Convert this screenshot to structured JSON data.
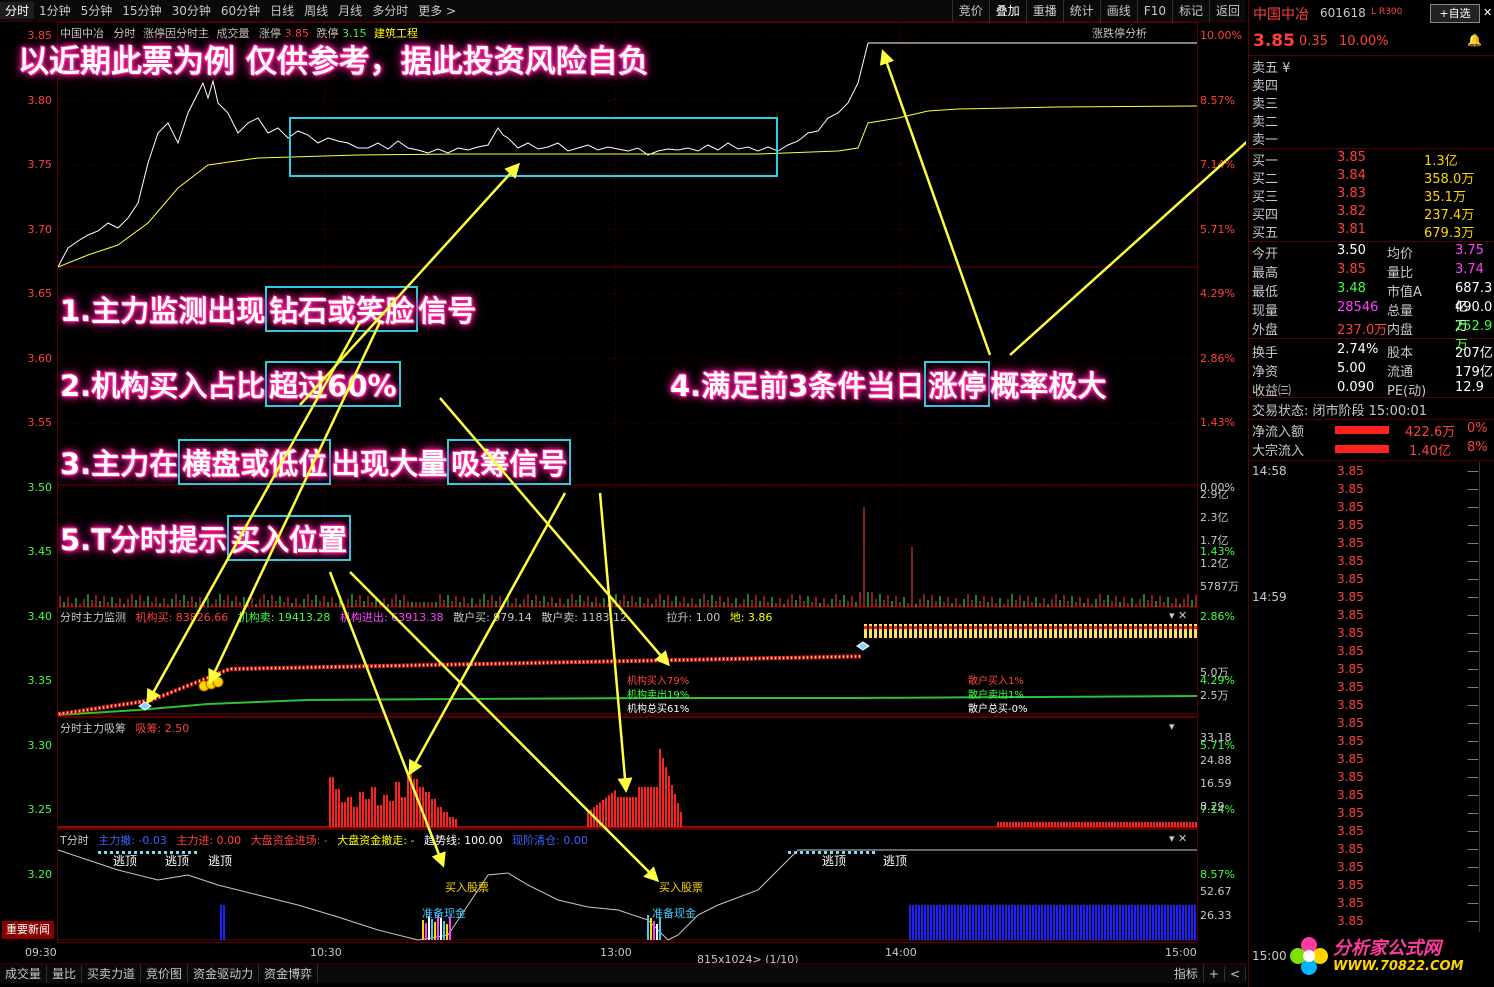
{
  "toolbar": {
    "tabs": [
      "分时",
      "1分钟",
      "5分钟",
      "15分钟",
      "30分钟",
      "60分钟",
      "日线",
      "周线",
      "月线",
      "多分时",
      "更多 >"
    ],
    "right": [
      "竞价",
      "叠加",
      "重播",
      "统计",
      "画线",
      "F10",
      "标记",
      "返回"
    ]
  },
  "main_header": {
    "name": "中国中冶",
    "mode": "分时",
    "limit_label": "涨停因分时主",
    "volume_label": "成交量",
    "up_label": "涨停",
    "up_val": "3.85",
    "down_label": "跌停",
    "down_val": "3.15",
    "sector": "建筑工程",
    "analysis_btn": "涨跌停分析"
  },
  "price_axis": [
    "3.85",
    "3.80",
    "3.75",
    "3.70",
    "3.65",
    "3.60",
    "3.55",
    "3.50",
    "3.45",
    "3.40",
    "3.35",
    "3.30",
    "3.25",
    "3.20"
  ],
  "pct_axis": [
    "10.00%",
    "8.57%",
    "7.14%",
    "5.71%",
    "4.29%",
    "2.86%",
    "1.43%",
    "0.00%",
    "1.43%",
    "2.86%",
    "4.29%",
    "5.71%",
    "7.14%",
    "8.57%"
  ],
  "vol_axis": [
    "2.9亿",
    "2.3亿",
    "1.7亿",
    "1.2亿",
    "5787万"
  ],
  "monitor": {
    "title": "分时主力监测",
    "org_buy": "机构买: 83826.66",
    "org_sell": "机构卖: 19413.28",
    "org_in": "机构进出: 63913.38",
    "retail_buy": "散户买: 979.14",
    "retail_sell": "散户卖: 1183.12",
    "raise_label": "拉升: 1.00",
    "ground": "地: 3.86",
    "axis": [
      "5.0万",
      "2.5万"
    ],
    "legend_org": [
      "机构买入79%",
      "机构卖出19%",
      "机构总买61%"
    ],
    "legend_retail": [
      "散户买入1%",
      "散户卖出1%",
      "散户总买-0%"
    ]
  },
  "accum": {
    "title": "分时主力吸筹",
    "value": "吸筹: 2.50",
    "axis": [
      "33.18",
      "24.88",
      "16.59",
      "8.29"
    ]
  },
  "tpanel": {
    "title": "T分时",
    "main_retreat": "主力撤: -0.03",
    "main_in": "主力进: 0.00",
    "market_in": "大盘资金进场: -",
    "market_out": "大盘资金撤走: -",
    "trend": "趋势线: 100.00",
    "cash": "现阶清仓: 0.00",
    "axis": [
      "52.67",
      "26.33"
    ],
    "flee": "逃顶",
    "buy": "买入股票",
    "prep": "准备现金"
  },
  "news_btn": "重要新闻",
  "time_axis": [
    "09:30",
    "10:30",
    "13:00",
    "14:00",
    "15:00"
  ],
  "page_info": "815x1024> (1/10)",
  "bottom_tabs": [
    "成交量",
    "量比",
    "买卖力道",
    "竞价图",
    "资金驱动力",
    "资金博弈"
  ],
  "bottom_right": [
    "指标",
    "+",
    "<"
  ],
  "annotations": {
    "title": "以近期此票为例  仅供参考，据此投资风险自负",
    "a1": [
      "1.主力监测出现",
      "钻石或笑脸",
      "信号"
    ],
    "a2": [
      "2.机构买入占比",
      "超过60%"
    ],
    "a3": [
      "3.主力在",
      "横盘或低位",
      "出现大量",
      "吸筹信号"
    ],
    "a4": [
      "4.满足前3条件当日",
      "涨停",
      "概率极大"
    ],
    "a5": [
      "5.T分时提示",
      "买入位置"
    ]
  },
  "quote": {
    "name": "中国中冶",
    "code": "601618",
    "flags": "L R300",
    "watch_btn": "+自选",
    "price": "3.85",
    "change": "0.35",
    "pct": "10.00%",
    "sells": [
      {
        "label": "卖五",
        "p": "",
        "v": ""
      },
      {
        "label": "卖四",
        "p": "",
        "v": ""
      },
      {
        "label": "卖三",
        "p": "",
        "v": ""
      },
      {
        "label": "卖二",
        "p": "",
        "v": ""
      },
      {
        "label": "卖一",
        "p": "",
        "v": ""
      }
    ],
    "buys": [
      {
        "label": "买一",
        "p": "3.85",
        "v": "1.3亿"
      },
      {
        "label": "买二",
        "p": "3.84",
        "v": "358.0万"
      },
      {
        "label": "买三",
        "p": "3.83",
        "v": "35.1万"
      },
      {
        "label": "买四",
        "p": "3.82",
        "v": "237.4万"
      },
      {
        "label": "买五",
        "p": "3.81",
        "v": "679.3万"
      }
    ],
    "stats": [
      [
        "今开",
        "3.50",
        "均价",
        "3.75"
      ],
      [
        "最高",
        "3.85",
        "量比",
        "3.74"
      ],
      [
        "最低",
        "3.48",
        "市值A",
        "687.3亿"
      ],
      [
        "现量",
        "28546",
        "总量",
        "490.0万"
      ],
      [
        "外盘",
        "237.0万",
        "内盘",
        "252.9万"
      ],
      [
        "换手",
        "2.74%",
        "股本",
        "207亿"
      ],
      [
        "净资",
        "5.00",
        "流通",
        "179亿"
      ],
      [
        "收益㈢",
        "0.090",
        "PE(动)",
        "12.9"
      ]
    ],
    "state": "交易状态: 闭市阶段 15:00:01",
    "netflow_label": "净流入额",
    "netflow_val": "422.6万",
    "netflow_pct": "0%",
    "block_label": "大宗流入",
    "block_val": "1.40亿",
    "block_pct": "8%",
    "ticks_time1": "14:58",
    "ticks_time2": "14:59",
    "tick_price": "3.85",
    "tick_end": "15:00",
    "logo_cn": "分析家公式网",
    "logo_url": "WWW.70822.COM",
    "currency": "¥"
  }
}
